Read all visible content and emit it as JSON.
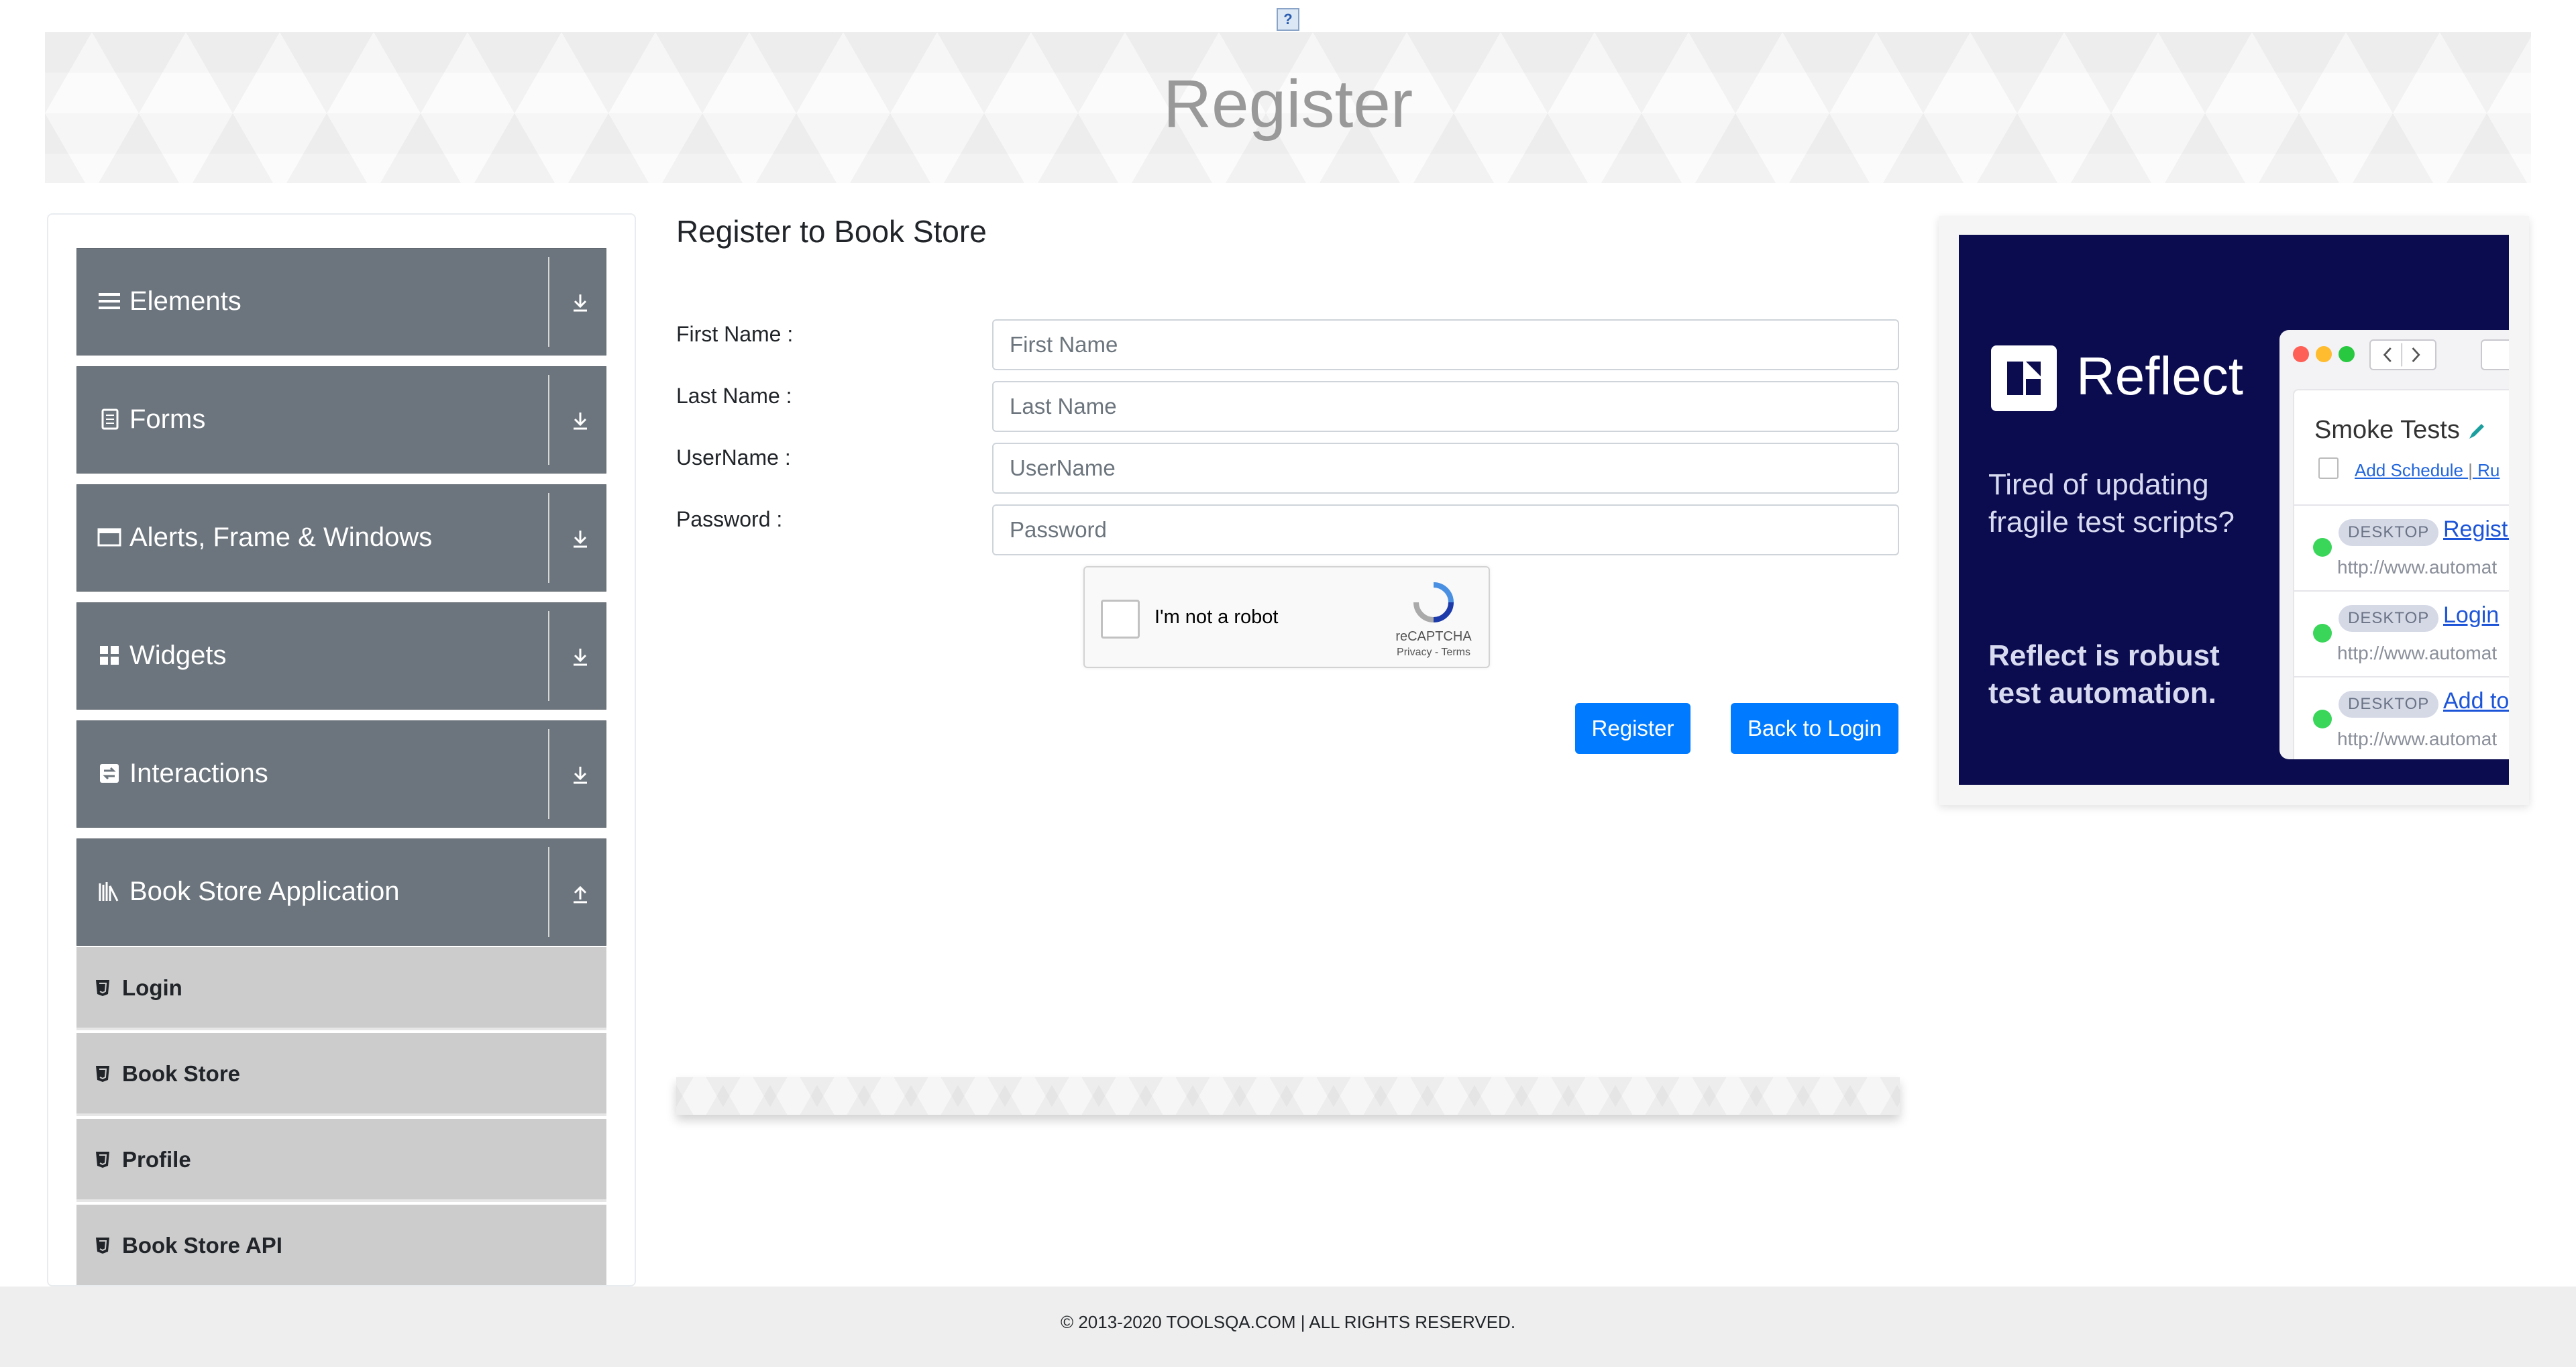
{
  "top_icon": "?",
  "banner": {
    "title": "Register"
  },
  "sidebar": {
    "groups": [
      {
        "label": "Elements",
        "icon": "hamburger-icon",
        "expanded": false
      },
      {
        "label": "Forms",
        "icon": "document-icon",
        "expanded": false
      },
      {
        "label": "Alerts, Frame & Windows",
        "icon": "window-icon",
        "expanded": false
      },
      {
        "label": "Widgets",
        "icon": "grid-icon",
        "expanded": false
      },
      {
        "label": "Interactions",
        "icon": "interaction-icon",
        "expanded": false
      },
      {
        "label": "Book Store Application",
        "icon": "books-icon",
        "expanded": true
      }
    ],
    "book_store_items": [
      {
        "label": "Login"
      },
      {
        "label": "Book Store"
      },
      {
        "label": "Profile"
      },
      {
        "label": "Book Store API"
      }
    ]
  },
  "form": {
    "heading": "Register to Book Store",
    "fields": [
      {
        "label": "First Name :",
        "placeholder": "First Name",
        "value": ""
      },
      {
        "label": "Last Name :",
        "placeholder": "Last Name",
        "value": ""
      },
      {
        "label": "UserName :",
        "placeholder": "UserName",
        "value": ""
      },
      {
        "label": "Password :",
        "placeholder": "Password",
        "value": ""
      }
    ],
    "captcha": {
      "label": "I'm not a robot",
      "brand": "reCAPTCHA",
      "links": "Privacy - Terms"
    },
    "register_label": "Register",
    "back_label": "Back to Login"
  },
  "ad": {
    "brand": "Reflect",
    "line1": "Tired of updating fragile test scripts?",
    "line2": "Reflect is robust test automation.",
    "card_title": "Smoke Tests",
    "schedule_link": "Add Schedule",
    "schedule_sep": "|",
    "schedule_more": "Ru",
    "rows": [
      {
        "tag": "DESKTOP",
        "link": "Registr",
        "url": "http://www.automat"
      },
      {
        "tag": "DESKTOP",
        "link": "Login",
        "url": "http://www.automat"
      },
      {
        "tag": "DESKTOP",
        "link": "Add to",
        "url": "http://www.automat"
      }
    ]
  },
  "footer": {
    "text": "© 2013-2020 TOOLSQA.COM | ALL RIGHTS RESERVED."
  },
  "colors": {
    "nav_bg": "#6c757d",
    "sub_bg": "#cccccc",
    "primary": "#007bff",
    "ad_bg": "#0b0b4f"
  }
}
